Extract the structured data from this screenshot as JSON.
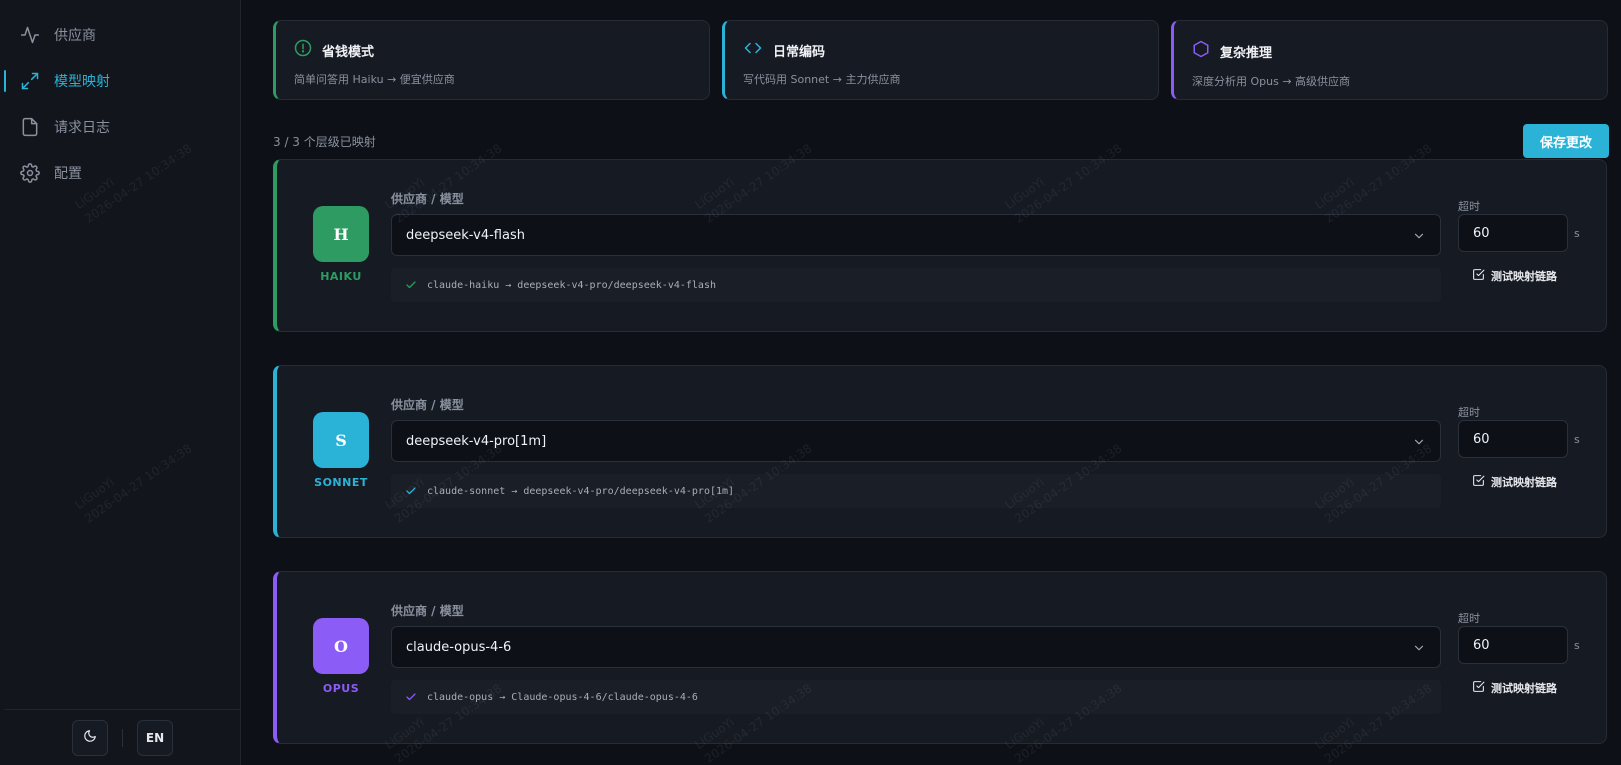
{
  "sidebar": {
    "items": [
      {
        "label": "供应商",
        "icon": "activity-icon",
        "active": false
      },
      {
        "label": "模型映射",
        "icon": "arrows-expand-icon",
        "active": true
      },
      {
        "label": "请求日志",
        "icon": "document-icon",
        "active": false
      },
      {
        "label": "配置",
        "icon": "gear-icon",
        "active": false
      }
    ],
    "footer": {
      "theme_icon": "moon-icon",
      "lang_label": "EN"
    }
  },
  "tier_cards": [
    {
      "title": "省钱模式",
      "desc": "简单问答用 Haiku → 便宜供应商",
      "icon": "dollar-circle-icon",
      "color": "#2e9b62"
    },
    {
      "title": "日常编码",
      "desc": "写代码用 Sonnet → 主力供应商",
      "icon": "code-brackets-icon",
      "color": "#2ab3d6"
    },
    {
      "title": "复杂推理",
      "desc": "深度分析用 Opus → 高级供应商",
      "icon": "hexagon-icon",
      "color": "#8b5cf6"
    }
  ],
  "status": {
    "mapped_count": "3 / 3 个层级已映射"
  },
  "toolbar": {
    "save_label": "保存更改"
  },
  "mappings": [
    {
      "badge": "H",
      "name": "HAIKU",
      "field_label": "供应商 / 模型",
      "model": "deepseek-v4-flash",
      "route": "claude-haiku → deepseek-v4-pro/deepseek-v4-flash",
      "timeout_label": "超时",
      "timeout": "60",
      "unit": "s",
      "test_label": "测试映射链路",
      "color": "#2e9b62"
    },
    {
      "badge": "S",
      "name": "SONNET",
      "field_label": "供应商 / 模型",
      "model": "deepseek-v4-pro[1m]",
      "route": "claude-sonnet → deepseek-v4-pro/deepseek-v4-pro[1m]",
      "timeout_label": "超时",
      "timeout": "60",
      "unit": "s",
      "test_label": "测试映射链路",
      "color": "#2ab3d6"
    },
    {
      "badge": "O",
      "name": "OPUS",
      "field_label": "供应商 / 模型",
      "model": "claude-opus-4-6",
      "route": "claude-opus → Claude-opus-4-6/claude-opus-4-6",
      "timeout_label": "超时",
      "timeout": "60",
      "unit": "s",
      "test_label": "测试映射链路",
      "color": "#8b5cf6"
    }
  ],
  "watermark": {
    "name": "LiGuoYi",
    "time": "2026-04-27 10:34:38"
  }
}
